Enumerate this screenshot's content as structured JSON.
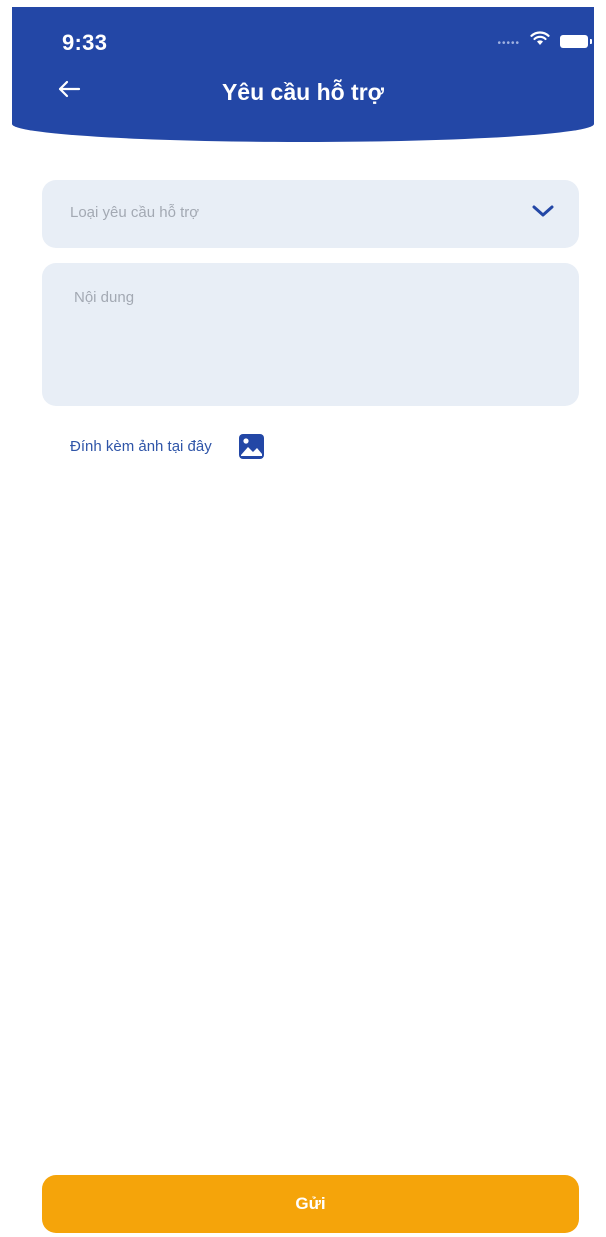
{
  "status_bar": {
    "time": "9:33",
    "signal_icon": "signal-dots-icon",
    "wifi_icon": "wifi-icon",
    "battery_icon": "battery-icon"
  },
  "header": {
    "back_icon": "arrow-left-icon",
    "title": "Yêu cầu hỗ trợ",
    "background_color": "#2347a6"
  },
  "form": {
    "request_type": {
      "placeholder": "Loại yêu cầu hỗ trợ",
      "value": "",
      "dropdown_icon": "chevron-down-icon"
    },
    "content": {
      "placeholder": "Nội dung",
      "value": ""
    },
    "attachment": {
      "label": "Đính kèm ảnh tại đây",
      "icon": "image-icon"
    }
  },
  "submit": {
    "label": "Gửi",
    "color": "#f5a40a"
  }
}
